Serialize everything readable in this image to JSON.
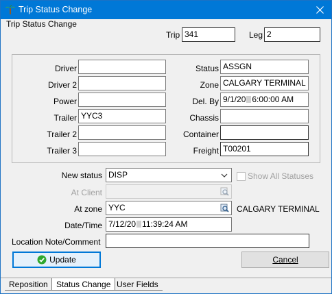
{
  "window": {
    "title": "Trip Status Change"
  },
  "form": {
    "section_label": "Trip Status Change",
    "trip_label": "Trip",
    "trip_value": "341",
    "leg_label": "Leg",
    "leg_value": "2",
    "driver_label": "Driver",
    "driver_value": "",
    "driver2_label": "Driver 2",
    "driver2_value": "",
    "power_label": "Power",
    "power_value": "",
    "trailer_label": "Trailer",
    "trailer_value": "YYC3",
    "trailer2_label": "Trailer 2",
    "trailer2_value": "",
    "trailer3_label": "Trailer 3",
    "trailer3_value": "",
    "status_label": "Status",
    "status_value": "ASSGN",
    "zone_label": "Zone",
    "zone_value": "CALGARY TERMINAL",
    "delby_label": "Del. By",
    "delby_date": "9/1/20",
    "delby_time": "6:00:00 AM",
    "chassis_label": "Chassis",
    "chassis_value": "",
    "container_label": "Container",
    "container_value": "",
    "freight_label": "Freight",
    "freight_value": "T00201",
    "new_status_label": "New status",
    "new_status_value": "DISP",
    "show_all_label": "Show All Statuses",
    "at_client_label": "At Client",
    "at_client_value": "",
    "at_zone_label": "At zone",
    "at_zone_value": "YYC",
    "at_zone_name": "CALGARY TERMINAL",
    "datetime_label": "Date/Time",
    "datetime_date": "7/12/20",
    "datetime_time": "11:39:24 AM",
    "location_note_label": "Location Note/Comment",
    "location_note_value": ""
  },
  "buttons": {
    "update_label": "Update",
    "cancel_label": "Cancel"
  },
  "tabs": [
    {
      "label": "Reposition"
    },
    {
      "label": "Status Change"
    },
    {
      "label": "User Fields"
    }
  ],
  "colors": {
    "titlebar": "#0078d7",
    "accent": "#0078d7",
    "ok_green": "#2fa82f"
  }
}
